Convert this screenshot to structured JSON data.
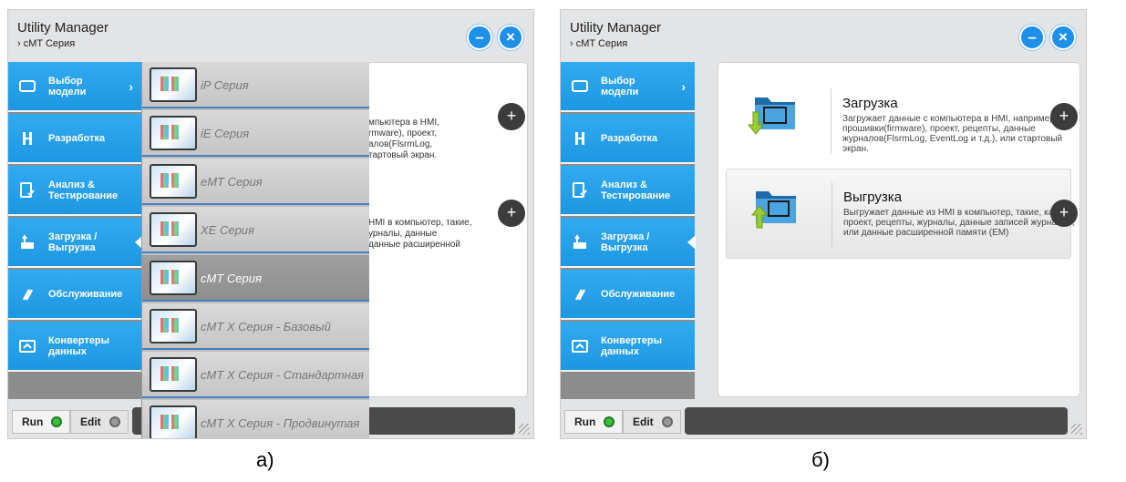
{
  "app_title": "Utility Manager",
  "breadcrumb": "› cMT Серия",
  "window": {
    "minimize_label": "–",
    "close_label": "×"
  },
  "sidebar": {
    "items": [
      {
        "label": "Выбор\nмодели",
        "chevron": "›",
        "icon": "monitor-icon"
      },
      {
        "label": "Разработка",
        "icon": "tools-icon"
      },
      {
        "label": "Анализ &\nТестирование",
        "icon": "checklist-icon"
      },
      {
        "label": "Загрузка /\nВыгрузка",
        "icon": "upload-download-icon"
      },
      {
        "label": "Обслуживание",
        "icon": "wrench-icon"
      },
      {
        "label": "Конвертеры\nданных",
        "icon": "convert-icon"
      }
    ]
  },
  "bottom": {
    "run_label": "Run",
    "edit_label": "Edit"
  },
  "panel_a": {
    "dropdown": [
      {
        "label": "iP Серия"
      },
      {
        "label": "iE Серия"
      },
      {
        "label": "eMT Серия"
      },
      {
        "label": "XE Серия"
      },
      {
        "label": "cMT Серия",
        "selected": true
      },
      {
        "label": "cMT X Серия - Базовый"
      },
      {
        "label": "cMT X Серия - Стандартная"
      },
      {
        "label": "cMT X Серия - Продвинутая"
      }
    ],
    "fragment_top": "мпьютера в HMI,\nrmware), проект,\nалов(FlsrmLog,\nтартовый экран.",
    "fragment_bottom": "HMI в компьютер, такие,\nурналы, данные\nданные расширенной"
  },
  "panel_b": {
    "cards": [
      {
        "title": "Загрузка",
        "desc": "Загружает данные с компьютера в HMI, например, прошивки(firmware), проект, рецепты, данные журналов(FlsrmLog, EventLog и т.д.), или стартовый экран."
      },
      {
        "title": "Выгрузка",
        "desc": "Выгружает данные из HMI в компьютер, такие, как проект, рецепты, журналы, данные записей журналов, или данные расширенной памяти (EM)"
      }
    ]
  },
  "plus_glyph": "+",
  "captions": {
    "a": "а)",
    "b": "б)"
  },
  "colors": {
    "accent": "#1e97e2",
    "sidebar_blue": "#31aaf0",
    "status_dark": "#4a4a4a",
    "run_green": "#3cbf3c"
  }
}
